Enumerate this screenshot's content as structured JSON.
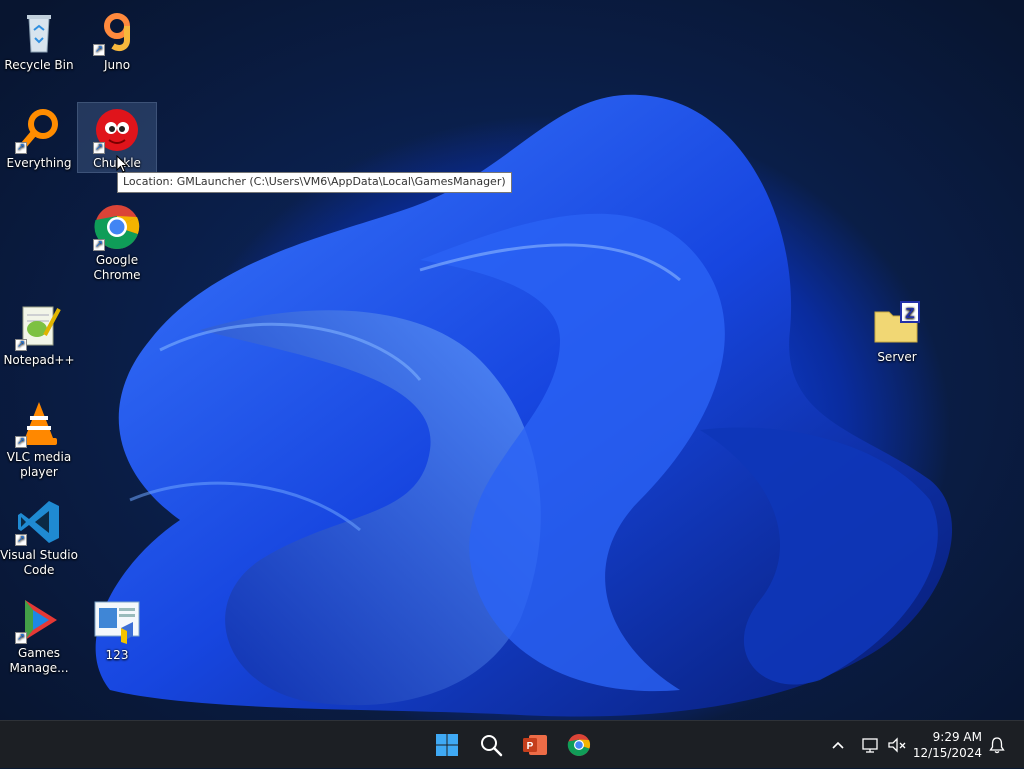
{
  "desktop": {
    "icons": {
      "recycle_bin": "Recycle Bin",
      "juno": "Juno",
      "everything": "Everything",
      "chuckle": "Chuckle",
      "chrome_line1": "Google",
      "chrome_line2": "Chrome",
      "notepadpp": "Notepad++",
      "vlc_line1": "VLC media",
      "vlc_line2": "player",
      "vscode_line1": "Visual Studio",
      "vscode_line2": "Code",
      "games_line1": "Games",
      "games_line2": "Manage...",
      "file_123": "123",
      "server": "Server"
    },
    "tooltip": "Location: GMLauncher (C:\\Users\\VM6\\AppData\\Local\\GamesManager)"
  },
  "taskbar": {
    "clock_time": "9:29 AM",
    "clock_date": "12/15/2024",
    "apps": [
      "start-icon",
      "search-icon",
      "powerpoint-icon",
      "chrome-icon"
    ]
  },
  "colors": {
    "taskbar_bg": "#1c1f24",
    "wallpaper_accent": "#1a5cff"
  }
}
